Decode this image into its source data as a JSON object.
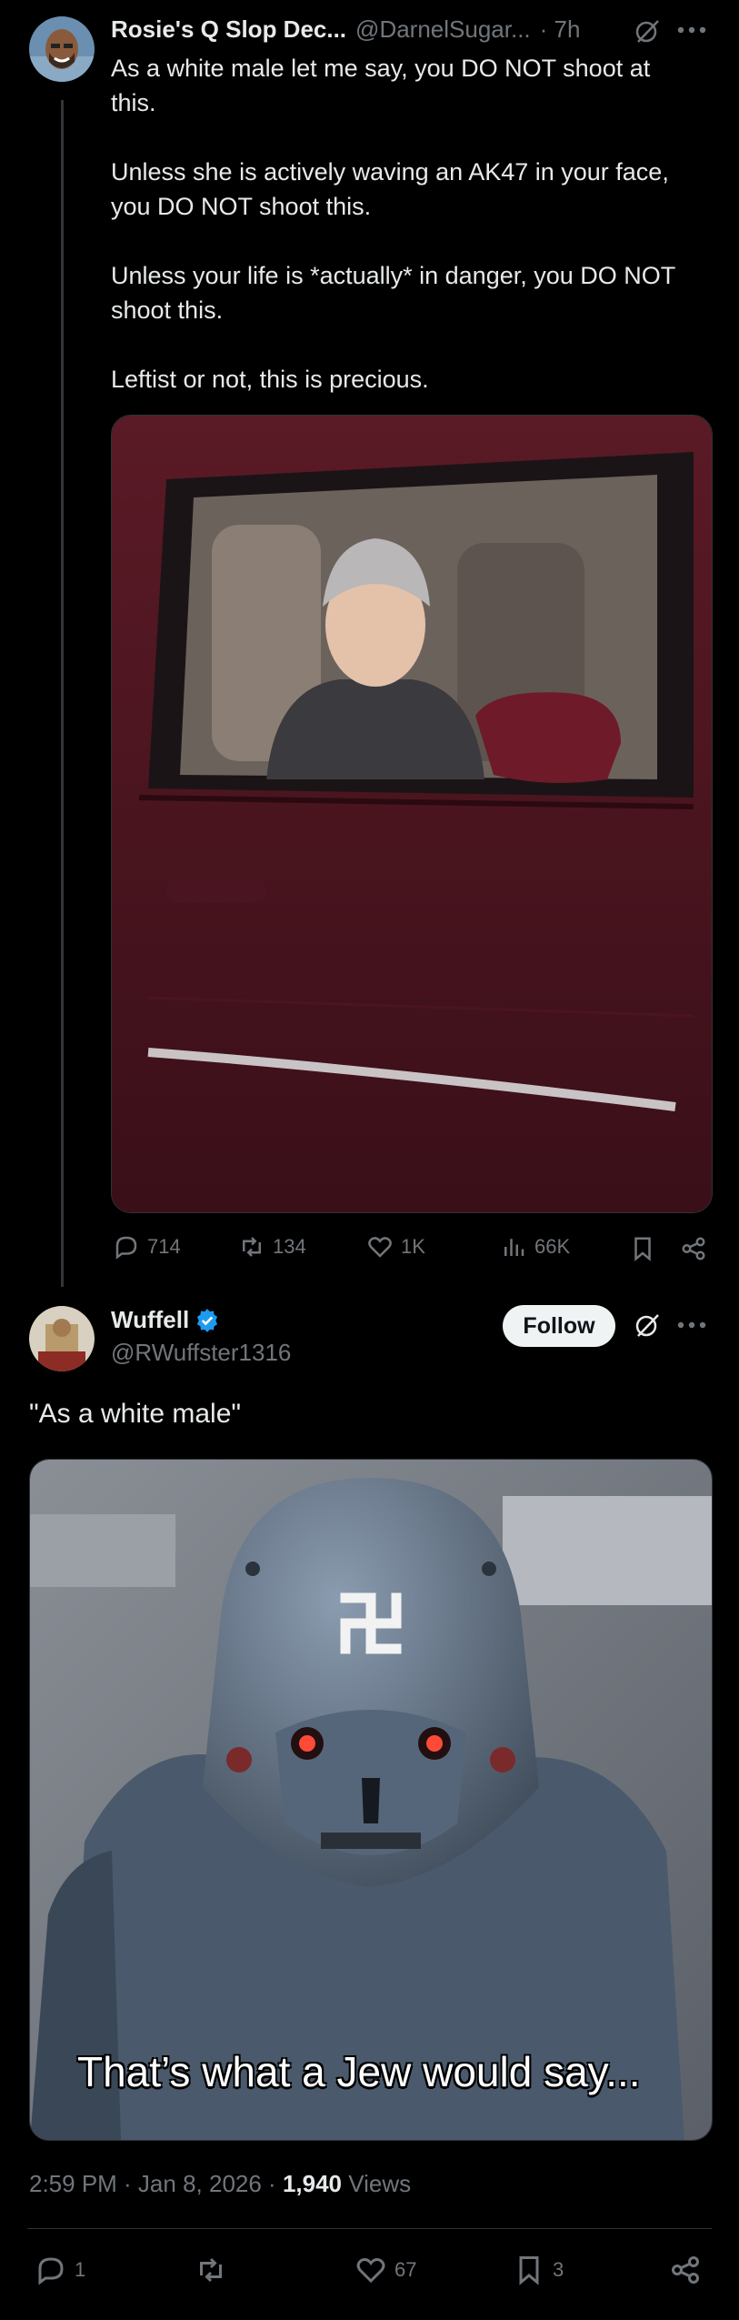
{
  "tweet1": {
    "display_name": "Rosie's Q Slop Dec...",
    "handle": "@DarnelSugar...",
    "time": "· 7h",
    "lines": [
      "As a white male let me say, you DO NOT shoot at",
      "this.",
      "Unless she is actively waving an AK47 in your face,",
      "you DO NOT shoot this.",
      "Unless your life is *actually* in danger, you DO NOT",
      "shoot this.",
      "Leftist or not, this is precious."
    ],
    "replies": "714",
    "retweets": "134",
    "likes": "1K",
    "views": "66K"
  },
  "tweet2": {
    "display_name": "Wuffell",
    "handle": "@RWuffster1316",
    "follow_label": "Follow",
    "text": "\"As a white male\"",
    "meme_caption": "That’s what a Jew would say...",
    "time": "2:59 PM · Jan 8, 2026 ·",
    "views_count": "1,940",
    "views_label": "Views",
    "replies": "1",
    "likes": "67",
    "bookmarks": "3"
  },
  "colors": {
    "accent": "#1d9bf0",
    "muted": "#71767b",
    "text": "#e7e9ea"
  },
  "icons": [
    "grok-icon",
    "more-icon",
    "reply-icon",
    "retweet-icon",
    "like-icon",
    "views-icon",
    "bookmark-icon",
    "share-icon",
    "verified-badge-icon"
  ]
}
